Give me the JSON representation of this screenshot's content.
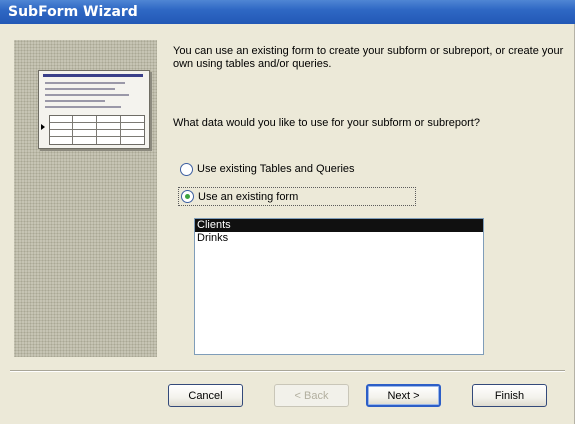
{
  "window": {
    "title": "SubForm Wizard"
  },
  "intro_text": "You can use an existing form to create your subform or subreport, or create your own using tables and/or queries.",
  "question_text": "What data would you like to use for your subform or subreport?",
  "options": [
    {
      "label": "Use existing Tables and Queries",
      "selected": false
    },
    {
      "label": "Use an existing form",
      "selected": true
    }
  ],
  "forms_list": {
    "items": [
      "Clients",
      "Drinks"
    ],
    "selected": "Clients"
  },
  "buttons": {
    "cancel": "Cancel",
    "back": "< Back",
    "next": "Next >",
    "finish": "Finish"
  },
  "colors": {
    "titlebar": "#2f68c4",
    "dialog_bg": "#ece9d8",
    "selection": "#101010",
    "default_button_border": "#2c5ec7"
  }
}
